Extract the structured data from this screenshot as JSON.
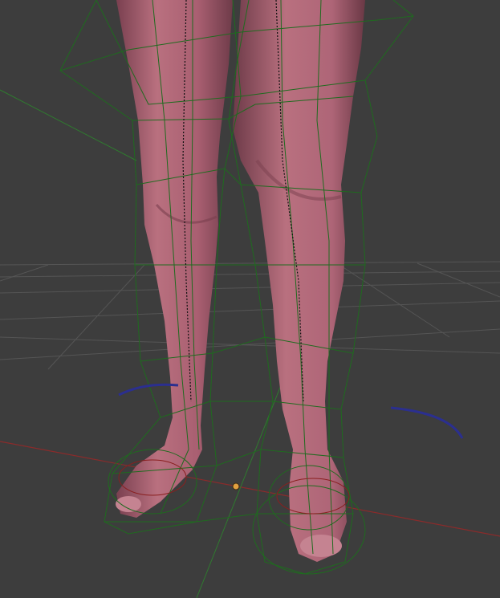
{
  "viewport": {
    "background": "#3d3d3d",
    "grid_color": "#555555",
    "x_axis_color": "#8a2b2b",
    "y_axis_color": "#2f7a2f",
    "skin_color": "#b76a7b",
    "skin_shadow": "#6e3b49",
    "cage_color": "#1f6b1f",
    "bone_color": "#111111",
    "curve_color": "#2b2f8f",
    "origin_color": "#e0a040",
    "icons": [
      "3d-origin-icon"
    ]
  }
}
